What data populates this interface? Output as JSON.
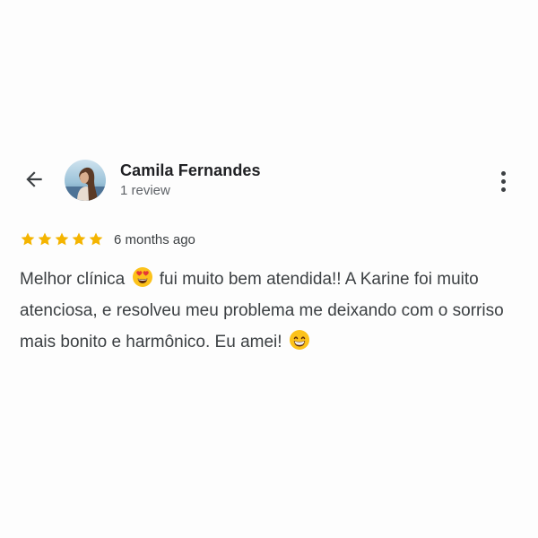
{
  "header": {
    "back_icon": "arrow-left-icon",
    "avatar_icon": "avatar-photo",
    "reviewer_name": "Camila Fernandes",
    "review_count": "1 review",
    "more_icon": "more-vert-icon"
  },
  "rating": {
    "stars": 5,
    "max_stars": 5,
    "star_color": "#f4b400",
    "date": "6 months ago"
  },
  "review": {
    "part1": "Melhor clínica",
    "emoji1": "heart-eyes-emoji",
    "part2": "fui muito bem atendida!! A Karine foi muito atenciosa, e resolveu meu problema me deixando com o sorriso mais bonito e harmônico. Eu amei!",
    "emoji2": "grinning-emoji"
  }
}
